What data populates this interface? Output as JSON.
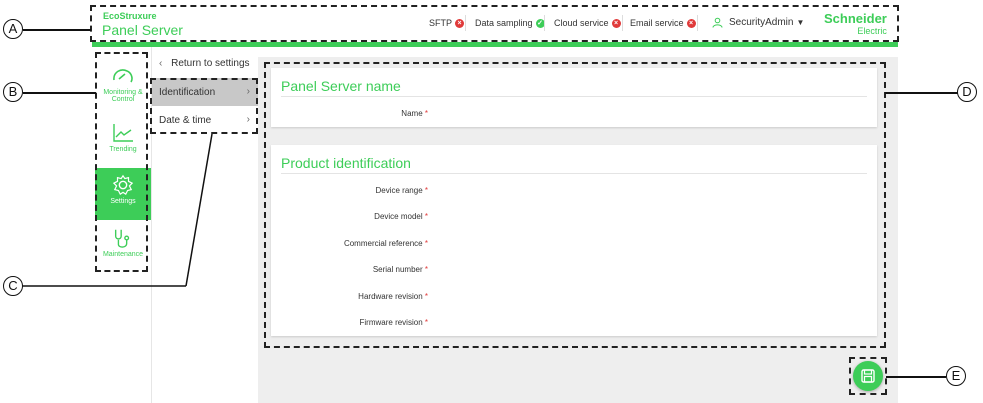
{
  "header": {
    "brand_top": "EcoStruxure",
    "brand_bottom": "Panel Server",
    "status_items": [
      {
        "label": "SFTP",
        "state": "error"
      },
      {
        "label": "Data sampling",
        "state": "ok"
      },
      {
        "label": "Cloud service",
        "state": "error"
      },
      {
        "label": "Email service",
        "state": "error"
      }
    ],
    "user": "SecurityAdmin",
    "vendor": "Schneider",
    "vendor_sub": "Electric"
  },
  "nav": {
    "items": [
      {
        "label": "Monitoring & Control",
        "icon": "gauge-icon"
      },
      {
        "label": "Trending",
        "icon": "trend-chart-icon"
      },
      {
        "label": "Settings",
        "icon": "gear-icon",
        "active": true
      },
      {
        "label": "Maintenance",
        "icon": "stethoscope-icon"
      }
    ]
  },
  "settings_menu": {
    "return_label": "Return to settings",
    "items": [
      {
        "label": "Identification",
        "active": true
      },
      {
        "label": "Date & time"
      }
    ]
  },
  "panel_name_card": {
    "title": "Panel Server name",
    "fields": [
      "Name"
    ]
  },
  "product_card": {
    "title": "Product identification",
    "fields": [
      "Device range",
      "Device model",
      "Commercial reference",
      "Serial number",
      "Hardware revision",
      "Firmware revision"
    ]
  },
  "callouts": [
    "A",
    "B",
    "C",
    "D",
    "E"
  ],
  "colors": {
    "accent": "#3dcd58",
    "error": "#e03a3a",
    "ok": "#3dcd58",
    "content_bg": "#eeeeee"
  }
}
